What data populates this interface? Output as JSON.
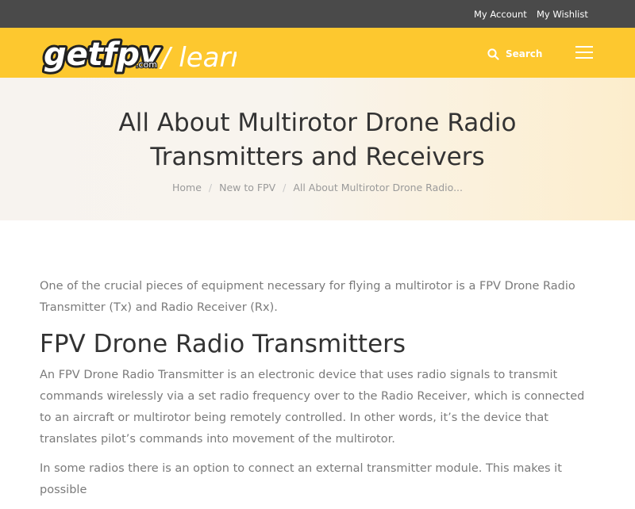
{
  "topbar": {
    "account": "My Account",
    "wishlist": "My Wishlist"
  },
  "header": {
    "logo_text": "getfpv",
    "logo_suffix": ".com",
    "logo_section": "/ learn",
    "search_label": "Search",
    "colors": {
      "accent": "#fdc82f",
      "topbar": "#4a4a4a"
    }
  },
  "hero": {
    "title": "All About Multirotor Drone Radio Transmitters and Receivers",
    "breadcrumb": [
      "Home",
      "New to FPV",
      "All About Multirotor Drone Radio..."
    ]
  },
  "article": {
    "intro": "One of the crucial pieces of equipment necessary for flying a multirotor is a FPV Drone Radio Transmitter (Tx) and Radio Receiver (Rx).",
    "heading": "FPV Drone Radio Transmitters",
    "para1": "An FPV Drone Radio Transmitter is an electronic device that uses radio signals to transmit commands wirelessly via a set radio frequency over to the Radio Receiver, which is connected to an aircraft or multirotor being remotely controlled. In other words, it’s the device that translates pilot’s commands into movement of the multirotor.",
    "para2": "In some radios there is an option to connect an external transmitter module. This makes it possible"
  }
}
